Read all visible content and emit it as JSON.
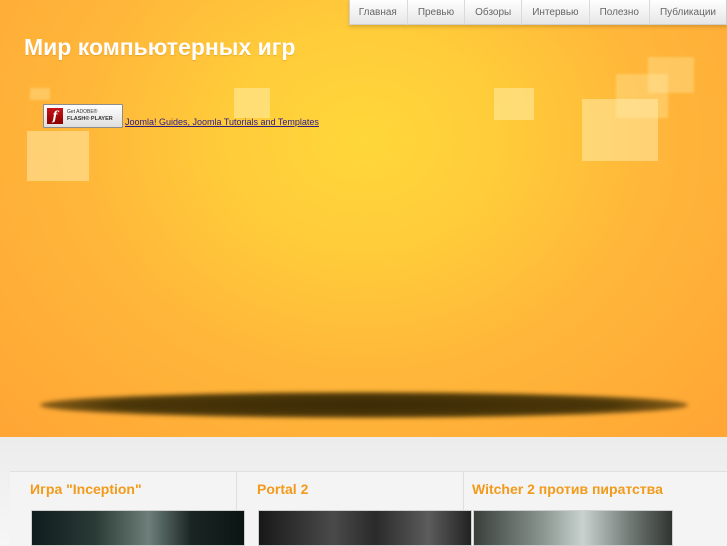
{
  "site": {
    "title": "Мир компьютерных игр"
  },
  "nav": {
    "items": [
      "Главная",
      "Превью",
      "Обзоры",
      "Интервью",
      "Полезно",
      "Публикации"
    ]
  },
  "flash": {
    "badge_line1": "Get ADOBE®",
    "badge_line2": "FLASH® PLAYER",
    "link_text": "Joomla! Guides, Joomla Tutorials and Templates"
  },
  "articles": [
    {
      "title": "Игра \"Inception\""
    },
    {
      "title": "Portal 2"
    },
    {
      "title": "Witcher 2 против пиратства"
    }
  ],
  "colors": {
    "accent": "#f29a1a",
    "hero_center": "#ffd73a",
    "hero_edge": "#ffa535"
  }
}
